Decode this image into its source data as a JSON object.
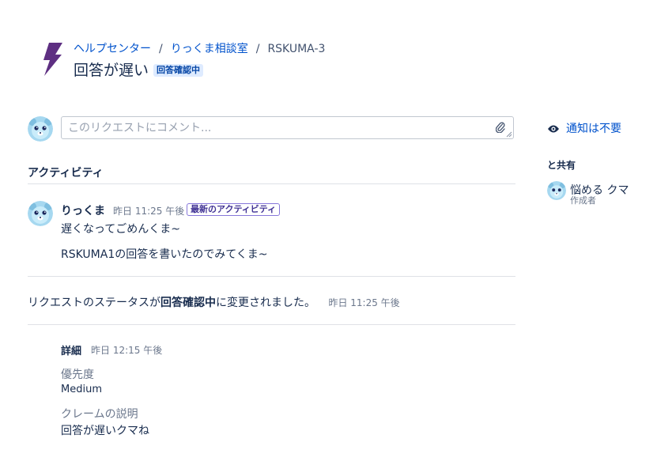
{
  "header": {
    "breadcrumb": [
      "ヘルプセンター",
      "りっくま相談室",
      "RSKUMA-3"
    ],
    "separator": "/",
    "title": "回答が遅い",
    "status": "回答確認中"
  },
  "comment": {
    "placeholder": "このリクエストにコメント..."
  },
  "sidebar": {
    "notify_label": "通知は不要",
    "shared_with_label": "と共有",
    "shared_users": [
      {
        "name": "悩める クマ",
        "role": "作成者"
      }
    ]
  },
  "activity": {
    "heading": "アクティビティ",
    "latest_comment": {
      "author": "りっくま",
      "time": "昨日 11:25 午後",
      "badge": "最新のアクティビティ",
      "lines": [
        "遅くなってごめんくま~",
        "RSKUMA1の回答を書いたのでみてくま~"
      ]
    },
    "status_change": {
      "prefix": "リクエストのステータスが",
      "status": "回答確認中",
      "suffix": "に変更されました。",
      "time": "昨日 11:25 午後"
    },
    "details": {
      "label": "詳細",
      "time": "昨日 12:15 午後",
      "fields": [
        {
          "label": "優先度",
          "value": "Medium"
        },
        {
          "label": "クレームの説明",
          "value": "回答が遅いクマね"
        }
      ]
    }
  },
  "colors": {
    "brand_bolt": "#5e2f82",
    "link": "#0052cc",
    "avatar_bg": "#a6d8f0"
  }
}
